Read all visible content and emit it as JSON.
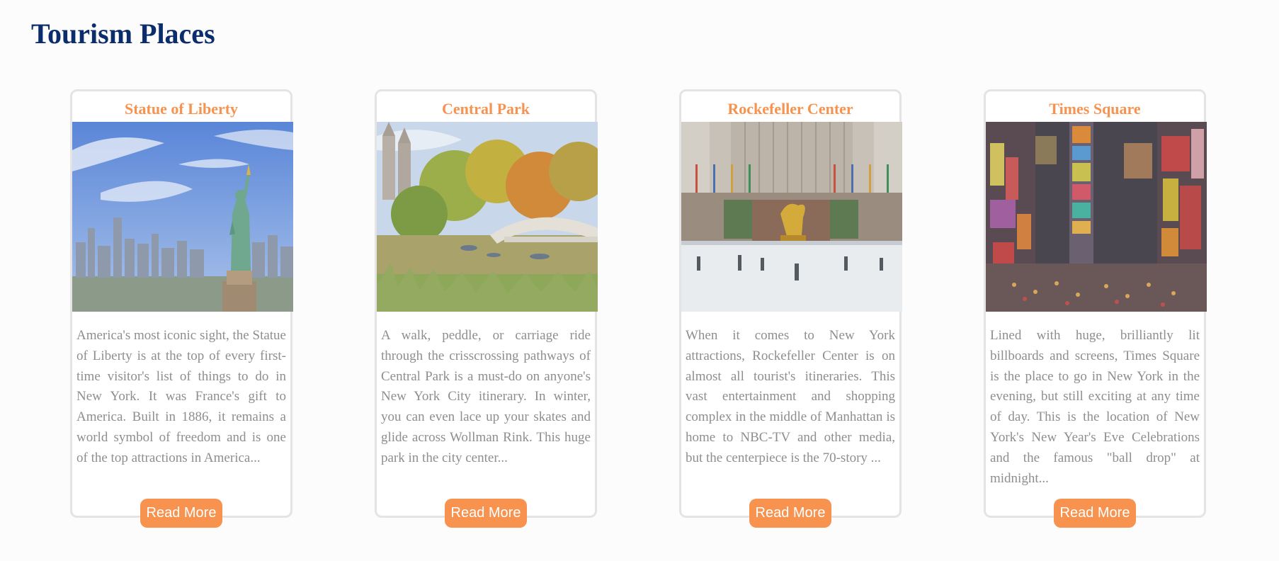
{
  "page": {
    "title": "Tourism Places"
  },
  "colors": {
    "title": "#0c2d6b",
    "card_title": "#f7924f",
    "button_bg": "#f7924f",
    "button_text": "#ffffff",
    "description": "#8e8e8e",
    "card_border": "#e4e4e4"
  },
  "cards": [
    {
      "title": "Statue of Liberty",
      "image": "statue-of-liberty-photo",
      "description": "America's most iconic sight, the Statue of Liberty is at the top of every first-time visitor's list of things to do in New York. It was France's gift to America. Built in 1886, it remains a world symbol of freedom and is one of the top attractions in America...",
      "button": "Read More"
    },
    {
      "title": "Central Park",
      "image": "central-park-photo",
      "description": "A walk, peddle, or carriage ride through the crisscrossing pathways of Central Park is a must-do on anyone's New York City itinerary. In winter, you can even lace up your skates and glide across Wollman Rink. This huge park in the city center...",
      "button": "Read More"
    },
    {
      "title": "Rockefeller Center",
      "image": "rockefeller-center-photo",
      "description": "When it comes to New York attractions, Rockefeller Center is on almost all tourist's itineraries. This vast entertainment and shopping complex in the middle of Manhattan is home to NBC-TV and other media, but the centerpiece is the 70-story ...",
      "button": "Read More"
    },
    {
      "title": "Times Square",
      "image": "times-square-photo",
      "description": "Lined with huge, brilliantly lit billboards and screens, Times Square is the place to go in New York in the evening, but still exciting at any time of day. This is the location of New York's New Year's Eve Celebrations and the famous \"ball drop\" at midnight...",
      "button": "Read More"
    }
  ]
}
